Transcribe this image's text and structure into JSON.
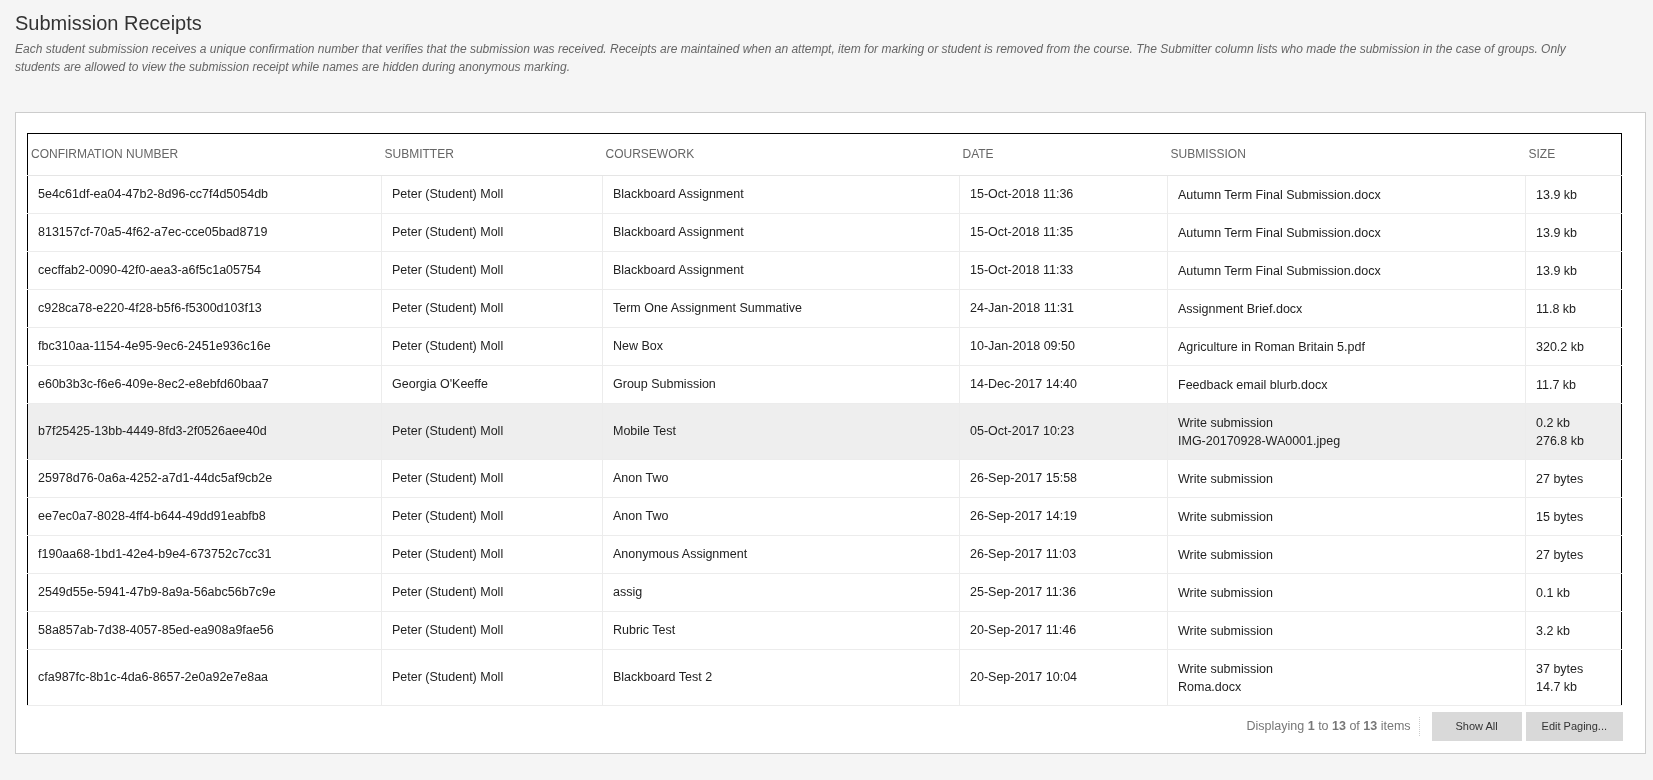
{
  "page": {
    "title": "Submission Receipts",
    "description": "Each student submission receives a unique confirmation number that verifies that the submission was received. Receipts are maintained when an attempt, item for marking or student is removed from the course. The Submitter column lists who made the submission in the case of groups. Only students are allowed to view the submission receipt while names are hidden during anonymous marking."
  },
  "table": {
    "columns": [
      "CONFIRMATION NUMBER",
      "SUBMITTER",
      "COURSEWORK",
      "DATE",
      "SUBMISSION",
      "SIZE"
    ],
    "rows": [
      {
        "confirmation": "5e4c61df-ea04-47b2-8d96-cc7f4d5054db",
        "submitter": "Peter (Student) Moll",
        "coursework": "Blackboard Assignment",
        "date": "15-Oct-2018 11:36",
        "submission": [
          "Autumn Term Final Submission.docx"
        ],
        "size": [
          "13.9 kb"
        ],
        "selected": false
      },
      {
        "confirmation": "813157cf-70a5-4f62-a7ec-cce05bad8719",
        "submitter": "Peter (Student) Moll",
        "coursework": "Blackboard Assignment",
        "date": "15-Oct-2018 11:35",
        "submission": [
          "Autumn Term Final Submission.docx"
        ],
        "size": [
          "13.9 kb"
        ],
        "selected": false
      },
      {
        "confirmation": "cecffab2-0090-42f0-aea3-a6f5c1a05754",
        "submitter": "Peter (Student) Moll",
        "coursework": "Blackboard Assignment",
        "date": "15-Oct-2018 11:33",
        "submission": [
          "Autumn Term Final Submission.docx"
        ],
        "size": [
          "13.9 kb"
        ],
        "selected": false
      },
      {
        "confirmation": "c928ca78-e220-4f28-b5f6-f5300d103f13",
        "submitter": "Peter (Student) Moll",
        "coursework": "Term One Assignment Summative",
        "date": "24-Jan-2018 11:31",
        "submission": [
          "Assignment Brief.docx"
        ],
        "size": [
          "11.8 kb"
        ],
        "selected": false
      },
      {
        "confirmation": "fbc310aa-1154-4e95-9ec6-2451e936c16e",
        "submitter": "Peter (Student) Moll",
        "coursework": "New Box",
        "date": "10-Jan-2018 09:50",
        "submission": [
          "Agriculture in Roman Britain 5.pdf"
        ],
        "size": [
          "320.2 kb"
        ],
        "selected": false
      },
      {
        "confirmation": "e60b3b3c-f6e6-409e-8ec2-e8ebfd60baa7",
        "submitter": "Georgia O'Keeffe",
        "coursework": "Group Submission",
        "date": "14-Dec-2017 14:40",
        "submission": [
          "Feedback email blurb.docx"
        ],
        "size": [
          "11.7 kb"
        ],
        "selected": false
      },
      {
        "confirmation": "b7f25425-13bb-4449-8fd3-2f0526aee40d",
        "submitter": "Peter (Student) Moll",
        "coursework": "Mobile Test",
        "date": "05-Oct-2017 10:23",
        "submission": [
          "Write submission",
          "IMG-20170928-WA0001.jpeg"
        ],
        "size": [
          "0.2 kb",
          "276.8 kb"
        ],
        "selected": true
      },
      {
        "confirmation": "25978d76-0a6a-4252-a7d1-44dc5af9cb2e",
        "submitter": "Peter (Student) Moll",
        "coursework": "Anon Two",
        "date": "26-Sep-2017 15:58",
        "submission": [
          "Write submission"
        ],
        "size": [
          "27 bytes"
        ],
        "selected": false
      },
      {
        "confirmation": "ee7ec0a7-8028-4ff4-b644-49dd91eabfb8",
        "submitter": "Peter (Student) Moll",
        "coursework": "Anon Two",
        "date": "26-Sep-2017 14:19",
        "submission": [
          "Write submission"
        ],
        "size": [
          "15 bytes"
        ],
        "selected": false
      },
      {
        "confirmation": "f190aa68-1bd1-42e4-b9e4-673752c7cc31",
        "submitter": "Peter (Student) Moll",
        "coursework": "Anonymous Assignment",
        "date": "26-Sep-2017 11:03",
        "submission": [
          "Write submission"
        ],
        "size": [
          "27 bytes"
        ],
        "selected": false
      },
      {
        "confirmation": "2549d55e-5941-47b9-8a9a-56abc56b7c9e",
        "submitter": "Peter (Student) Moll",
        "coursework": "assig",
        "date": "25-Sep-2017 11:36",
        "submission": [
          "Write submission"
        ],
        "size": [
          "0.1 kb"
        ],
        "selected": false
      },
      {
        "confirmation": "58a857ab-7d38-4057-85ed-ea908a9fae56",
        "submitter": "Peter (Student) Moll",
        "coursework": "Rubric Test",
        "date": "20-Sep-2017 11:46",
        "submission": [
          "Write submission"
        ],
        "size": [
          "3.2 kb"
        ],
        "selected": false
      },
      {
        "confirmation": "cfa987fc-8b1c-4da6-8657-2e0a92e7e8aa",
        "submitter": "Peter (Student) Moll",
        "coursework": "Blackboard Test 2",
        "date": "20-Sep-2017 10:04",
        "submission": [
          "Write submission",
          "Roma.docx"
        ],
        "size": [
          "37 bytes",
          "14.7 kb"
        ],
        "selected": false
      }
    ]
  },
  "footer": {
    "paging_status": "Displaying **1** to **13** of **13** items",
    "buttons": [
      "Show All",
      "Edit Paging..."
    ]
  }
}
